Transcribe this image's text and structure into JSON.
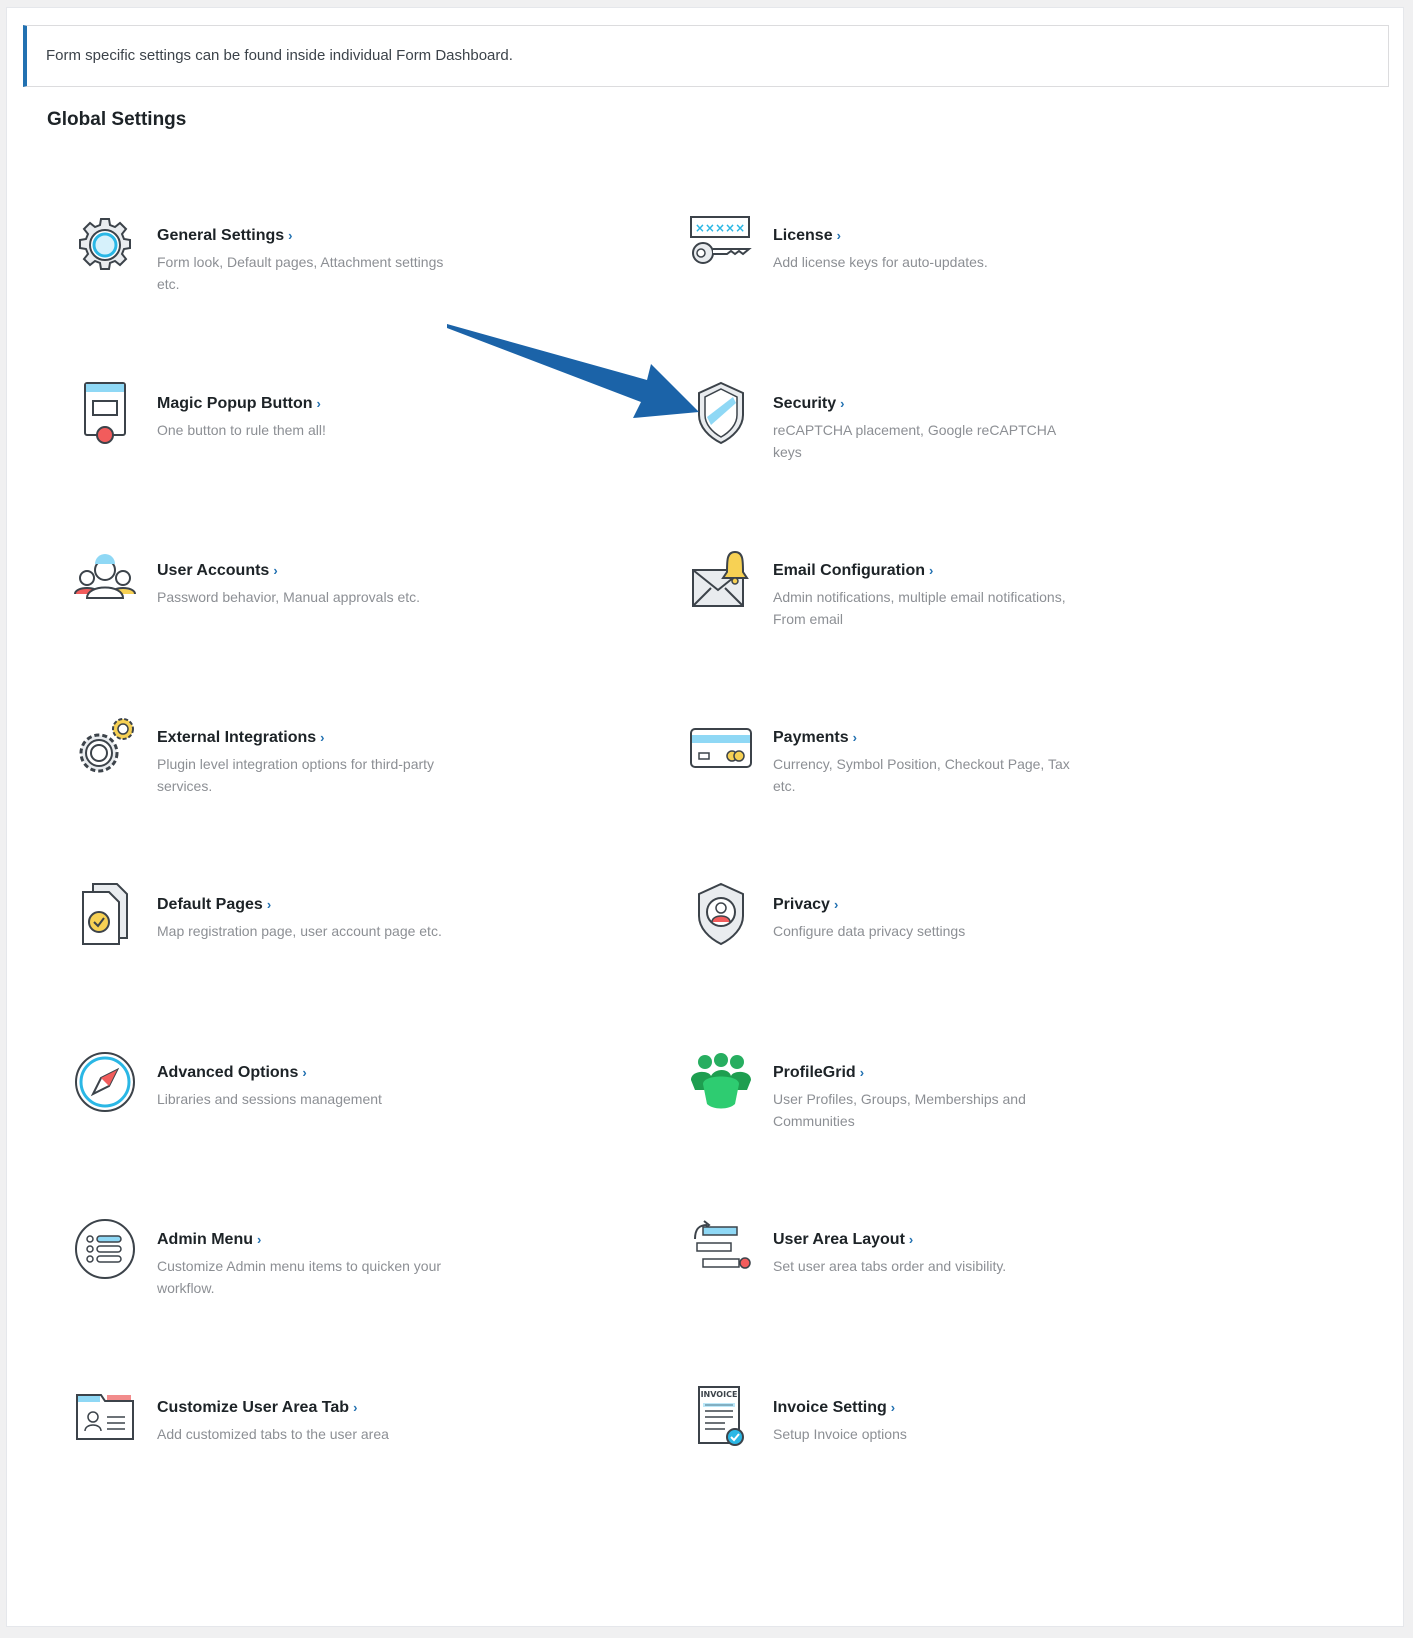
{
  "notice": {
    "text": "Form specific settings can be found inside individual Form Dashboard."
  },
  "page": {
    "heading": "Global Settings"
  },
  "chevron": "›",
  "colors": {
    "accent": "#2271b1",
    "arrow": "#1b63a8",
    "muted": "#8c8f94"
  },
  "settings": [
    {
      "title": "General Settings",
      "desc": "Form look, Default pages, Attachment settings etc.",
      "icon": "gear-icon"
    },
    {
      "title": "License",
      "desc": "Add license keys for auto-updates.",
      "icon": "key-icon"
    },
    {
      "title": "Magic Popup Button",
      "desc": "One button to rule them all!",
      "icon": "popup-button-icon"
    },
    {
      "title": "Security",
      "desc": "reCAPTCHA placement, Google reCAPTCHA keys",
      "icon": "shield-icon"
    },
    {
      "title": "User Accounts",
      "desc": "Password behavior, Manual approvals etc.",
      "icon": "users-icon"
    },
    {
      "title": "Email Configuration",
      "desc": "Admin notifications, multiple email notifications, From email",
      "icon": "email-bell-icon"
    },
    {
      "title": "External Integrations",
      "desc": "Plugin level integration options for third-party services.",
      "icon": "gears-icon"
    },
    {
      "title": "Payments",
      "desc": "Currency, Symbol Position, Checkout Page, Tax etc.",
      "icon": "credit-card-icon"
    },
    {
      "title": "Default Pages",
      "desc": "Map registration page, user account page etc.",
      "icon": "pages-icon"
    },
    {
      "title": "Privacy",
      "desc": "Configure data privacy settings",
      "icon": "privacy-shield-icon"
    },
    {
      "title": "Advanced Options",
      "desc": "Libraries and sessions management",
      "icon": "compass-icon"
    },
    {
      "title": "ProfileGrid",
      "desc": "User Profiles, Groups, Memberships and Communities",
      "icon": "profilegrid-icon"
    },
    {
      "title": "Admin Menu",
      "desc": "Customize Admin menu items to quicken your workflow.",
      "icon": "menu-list-icon"
    },
    {
      "title": "User Area Layout",
      "desc": "Set user area tabs order and visibility.",
      "icon": "layout-tabs-icon"
    },
    {
      "title": "Customize User Area Tab",
      "desc": "Add customized tabs to the user area",
      "icon": "user-card-icon"
    },
    {
      "title": "Invoice Setting",
      "desc": "Setup Invoice options",
      "icon": "invoice-icon"
    }
  ],
  "invoice_icon_text": "INVOICE",
  "license_icon_text": "×××××"
}
